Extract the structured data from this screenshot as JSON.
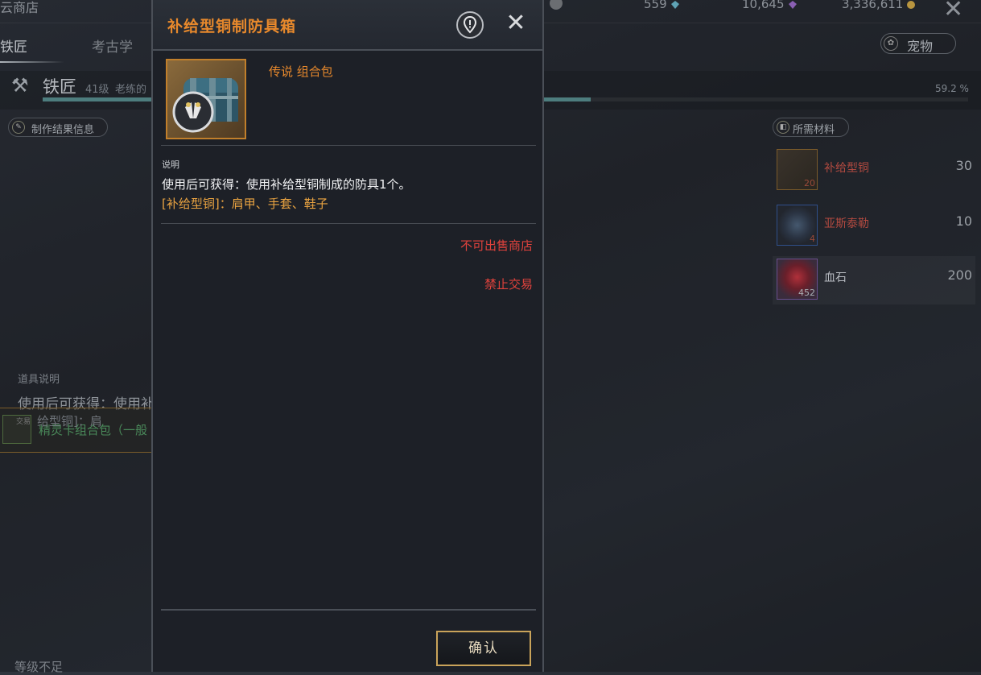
{
  "background": {
    "shop_label": "云商店",
    "currencies": [
      {
        "value": "559",
        "icon": "blue-crystal-icon",
        "color": "#5fa3b5"
      },
      {
        "value": "10,645",
        "icon": "purple-crystal-icon",
        "color": "#8a5fb3"
      },
      {
        "value": "3,336,611",
        "icon": "gold-coin-icon",
        "color": "#b8953f"
      }
    ],
    "tabs": [
      "铁匠",
      "考古学"
    ],
    "pet_button": "宠物",
    "skill": {
      "name": "铁匠",
      "level": "41级",
      "subtitle": "老练的",
      "progress_text": "59.2 %",
      "progress": 0.592
    },
    "result_info_label": "制作结果信息",
    "materials_label": "所需材料",
    "materials": [
      {
        "name": "补给型铜",
        "count": "20",
        "required": "30",
        "name_color": "#b24a40",
        "border": "#7a5a2a"
      },
      {
        "name": "亚斯泰勒",
        "count": "4",
        "required": "10",
        "name_color": "#b24a40",
        "border": "#2f4f8a"
      },
      {
        "name": "血石",
        "count": "452",
        "required": "200",
        "name_color": "#b6bac0",
        "border": "#6a4f8e"
      }
    ],
    "item_desc_label": "道具说明",
    "item_desc_line1": "使用后可获得：使用补",
    "item_desc_line2": "给型铜]：肩",
    "selected_item_tag": "交易",
    "selected_item_name": "精灵卡组合包（一般",
    "level_warning": "等级不足"
  },
  "modal": {
    "title": "补给型铜制防具箱",
    "grade_text": "传说 组合包",
    "description_label": "说明",
    "description_line1": "使用后可获得：使用补给型铜制成的防具1个。",
    "description_line2": "[补给型铜]：肩甲、手套、鞋子",
    "restriction_shop": "不可出售商店",
    "restriction_trade": "禁止交易",
    "confirm_label": "确认",
    "title_color": "#e8892c"
  }
}
